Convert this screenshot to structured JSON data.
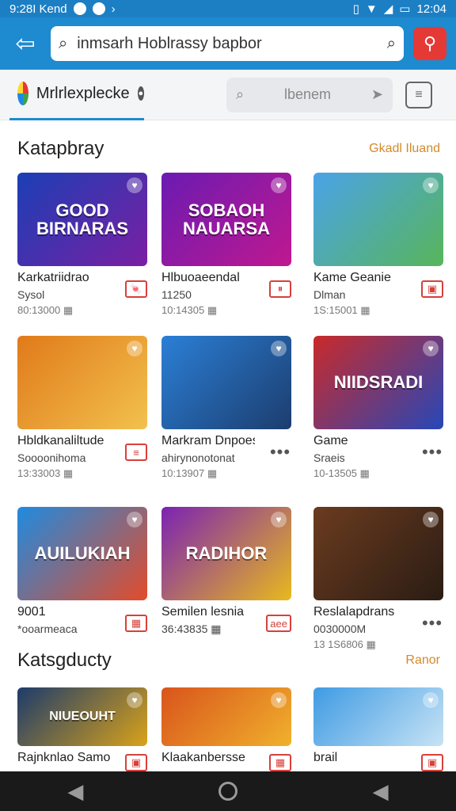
{
  "status_bar": {
    "left_text": "9:28I Kend",
    "time": "12:04"
  },
  "header": {
    "back_icon": "arrow-left-icon",
    "search_value": "inmsarh Hoblrassy bapbor",
    "search_icon": "search-icon",
    "action_icon": "share-icon"
  },
  "tabs": {
    "brand_label": "Mrlrlexplecke",
    "brand_badge": "●",
    "filter_placeholder": "lbenem"
  },
  "sections": [
    {
      "title": "Katapbray",
      "link": "Gkadl Iluand"
    },
    {
      "title": "Katsgducty",
      "link": "Ranor"
    }
  ],
  "games": [
    {
      "title": "Karkatriidrao",
      "sub": "Sysol",
      "meta": "80:13000 ▦",
      "action": "🍬",
      "thumb_text": "GOOD BIRNARAS",
      "colors": [
        "#1b3fb5",
        "#7a1fa3"
      ]
    },
    {
      "title": "Hlbuoaeendal",
      "sub": "11250",
      "meta": "10:14305 ▦",
      "action": "⏸",
      "thumb_text": "SOBAOH NAUARSA",
      "colors": [
        "#6a1bb2",
        "#c0188f"
      ]
    },
    {
      "title": "Kame Geanie",
      "sub": "Dlman",
      "meta": "1S:15001 ▦",
      "action": "▣",
      "thumb_text": "",
      "colors": [
        "#4aa3e8",
        "#58b55a"
      ]
    },
    {
      "title": "Hbldkanaliltude",
      "sub": "Soooonihoma",
      "meta": "13:33003 ▦",
      "action": "≡",
      "thumb_text": "",
      "colors": [
        "#e07a1a",
        "#f2c14e"
      ]
    },
    {
      "title": "Markram Dnpoesekan",
      "sub": "ahirynonotonat",
      "meta": "10:13907 ▦",
      "action": "•••",
      "thumb_text": "",
      "colors": [
        "#2b7fd6",
        "#1c3d6e"
      ]
    },
    {
      "title": "Game",
      "sub": "Sraeis",
      "meta": "10-13505 ▦",
      "action": "•••",
      "thumb_text": "NIIDSRADI",
      "colors": [
        "#c92a2a",
        "#2747b8"
      ]
    },
    {
      "title": "9001",
      "sub": "*ooarmeaca",
      "meta": "",
      "action": "▦",
      "thumb_text": "AUILUKIAH",
      "colors": [
        "#1f8be0",
        "#e34b2a"
      ]
    },
    {
      "title": "Semilen lesnia",
      "sub": "36:43835 ▦",
      "meta": "",
      "action": "aee",
      "thumb_text": "RADIHOR",
      "colors": [
        "#7b22b3",
        "#e8b91d"
      ]
    },
    {
      "title": "Reslalapdrans",
      "sub": "0030000M",
      "meta": "13 1S6806 ▦",
      "action": "•••",
      "thumb_text": "",
      "colors": [
        "#6b3b1f",
        "#2a1c14"
      ]
    },
    {
      "title": "Rajnknlao Samor",
      "sub": "",
      "meta": "",
      "action": "▣",
      "thumb_text": "NIUEOUHT",
      "colors": [
        "#1d3b6b",
        "#d9a21a"
      ]
    },
    {
      "title": "Klaakanbersse",
      "sub": "",
      "meta": "",
      "action": "▦",
      "thumb_text": "",
      "colors": [
        "#d9541c",
        "#f0b12c"
      ]
    },
    {
      "title": "brail",
      "sub": "",
      "meta": "",
      "action": "▣",
      "thumb_text": "",
      "colors": [
        "#3f9be3",
        "#c7e3f5"
      ]
    }
  ],
  "nav": {
    "back_icon": "triangle-back-icon",
    "home_icon": "circle-home-icon",
    "recents_icon": "triangle-recents-icon"
  }
}
